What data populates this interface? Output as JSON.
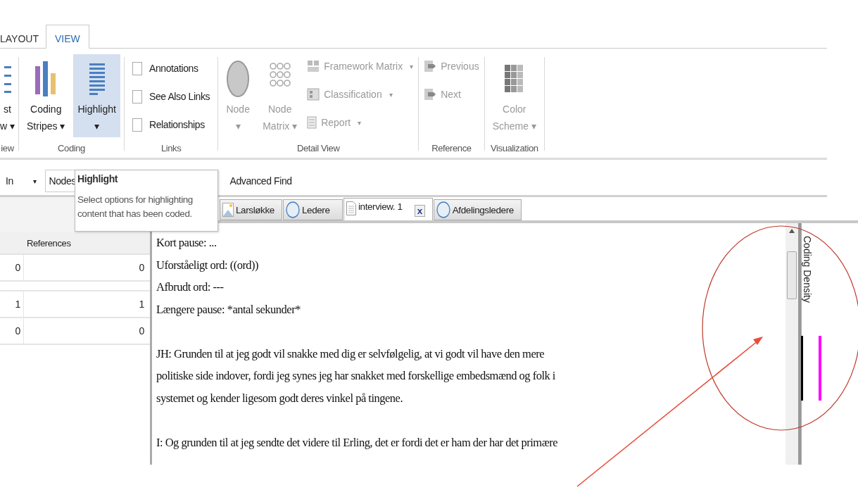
{
  "ribbon_tabs": [
    {
      "label": "LAYOUT",
      "selected": false
    },
    {
      "label": "VIEW",
      "selected": true
    }
  ],
  "ribbon_groups": [
    {
      "label": "iew",
      "items": [
        {
          "kind": "large",
          "lines": [
            "st",
            "w ▾"
          ],
          "disabled": false,
          "selected": false
        }
      ]
    },
    {
      "label": "Coding",
      "items": [
        {
          "kind": "large",
          "lines": [
            "Coding",
            "Stripes ▾"
          ],
          "disabled": false,
          "selected": false
        },
        {
          "kind": "large",
          "lines": [
            "Highlight",
            "▾"
          ],
          "disabled": false,
          "selected": true
        }
      ]
    },
    {
      "label": "Links",
      "items": [
        {
          "kind": "check",
          "label": "Annotations",
          "checked": false
        },
        {
          "kind": "check",
          "label": "See Also Links",
          "checked": false
        },
        {
          "kind": "check",
          "label": "Relationships",
          "checked": false
        }
      ]
    },
    {
      "label": "Detail View",
      "items": [
        {
          "kind": "large",
          "lines": [
            "Node",
            "▾"
          ],
          "disabled": true,
          "selected": false
        },
        {
          "kind": "large",
          "lines": [
            "Node",
            "Matrix ▾"
          ],
          "disabled": true,
          "selected": false
        },
        {
          "kind": "small",
          "label": "Framework Matrix",
          "caret": "▾",
          "disabled": true
        },
        {
          "kind": "small",
          "label": "Classification",
          "caret": "▾",
          "disabled": true
        },
        {
          "kind": "small",
          "label": "Report",
          "caret": "▾",
          "disabled": true
        }
      ]
    },
    {
      "label": "Reference",
      "items": [
        {
          "kind": "small",
          "label": "Previous",
          "disabled": true
        },
        {
          "kind": "small",
          "label": "Next",
          "disabled": true
        }
      ]
    },
    {
      "label": "Visualization",
      "items": [
        {
          "kind": "large",
          "lines": [
            "Color",
            "Scheme ▾"
          ],
          "disabled": true,
          "selected": false
        }
      ]
    }
  ],
  "find_bar": {
    "look_in": "In",
    "caret": "▾",
    "field_value": "Nodes",
    "advanced_find": "Advanced Find"
  },
  "tooltip": {
    "title": "Highlight",
    "text": "Select options for highlighting content that has been coded."
  },
  "grid": {
    "columns": [
      "References"
    ],
    "rows": [
      {
        "column_1": "0",
        "references": "0"
      },
      {
        "column_1": "1",
        "references": "1"
      },
      {
        "column_1": "0",
        "references": "0"
      }
    ]
  },
  "doc_tabs": [
    {
      "label": "Larsløkke",
      "kind": "image",
      "selected": false
    },
    {
      "label": "Ledere",
      "kind": "node",
      "selected": false
    },
    {
      "label": "interview. 1",
      "kind": "document",
      "selected": true,
      "close": "x"
    },
    {
      "label": "Afdelingsledere",
      "kind": "node",
      "selected": false
    }
  ],
  "document_paragraphs": [
    [
      "Kort pause: ...",
      "Uforståeligt ord: ((ord))",
      "Afbrudt ord: ---",
      "Længere pause: *antal sekunder*"
    ],
    [
      "JH: Grunden til at jeg godt vil snakke med dig er selvfølgelig, at vi godt vil have den mere",
      "politiske side indover, fordi jeg synes jeg har snakket med forskellige embedsmænd og folk i",
      "systemet og kender ligesom godt deres vinkel på tingene."
    ],
    [
      "I: Og grunden til at jeg sendte det videre til Erling, det er fordi det er ham der har det primære"
    ]
  ],
  "coding_density": {
    "label": "Coding Density",
    "stripes": [
      {
        "color": "#000000"
      },
      {
        "color": "#ff00ff"
      }
    ]
  }
}
